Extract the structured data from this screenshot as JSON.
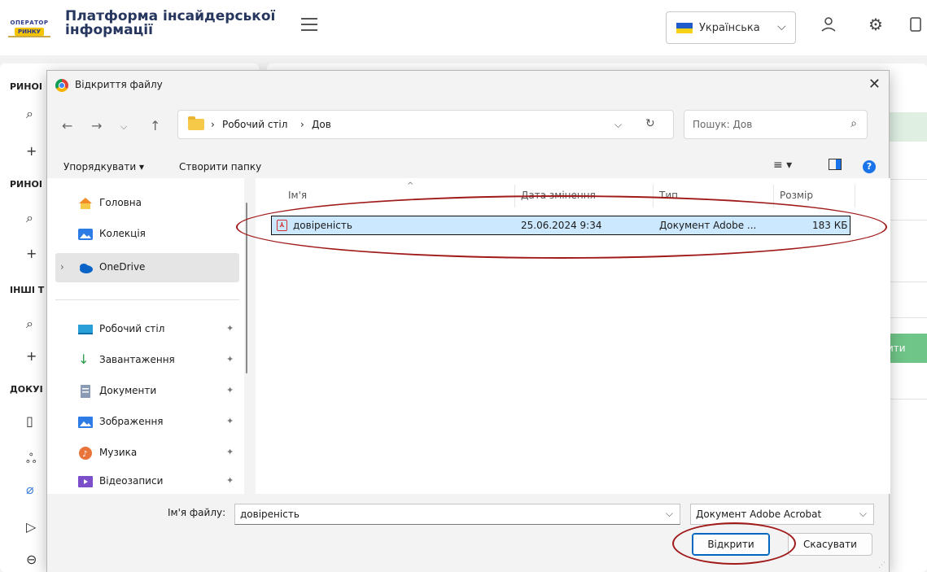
{
  "app": {
    "logo_text": "ОПЕРАТОР РИНКУ",
    "title": "Платформа інсайдерської інформації",
    "language": "Українська"
  },
  "sidebar": {
    "headers": [
      "РИНОІ",
      "РИНОІ",
      "ІНШІ Т",
      "ДОКУІ"
    ]
  },
  "main": {
    "green_button_label": "ити"
  },
  "dialog": {
    "title": "Відкриття файлу",
    "breadcrumb": [
      "Робочий стіл",
      "Дов"
    ],
    "search_placeholder": "Пошук: Дов",
    "toolbar": {
      "organize": "Упорядкувати ▾",
      "new_folder": "Створити папку"
    },
    "nav_items": [
      {
        "label": "Головна",
        "icon": "home-icon",
        "pinned": false
      },
      {
        "label": "Колекція",
        "icon": "gallery-icon",
        "pinned": false
      },
      {
        "label": "OneDrive",
        "icon": "cloud-icon",
        "pinned": false,
        "selected": true
      },
      {
        "label": "Робочий стіл",
        "icon": "desktop-icon",
        "pinned": true
      },
      {
        "label": "Завантаження",
        "icon": "download-icon",
        "pinned": true
      },
      {
        "label": "Документи",
        "icon": "documents-icon",
        "pinned": true
      },
      {
        "label": "Зображення",
        "icon": "pictures-icon",
        "pinned": true
      },
      {
        "label": "Музика",
        "icon": "music-icon",
        "pinned": true
      },
      {
        "label": "Відеозаписи",
        "icon": "videos-icon",
        "pinned": true
      }
    ],
    "columns": [
      "Ім'я",
      "Дата змінення",
      "Тип",
      "Розмір"
    ],
    "files": [
      {
        "name": "довіреність",
        "modified": "25.06.2024 9:34",
        "type": "Документ Adobe ...",
        "size": "183 КБ"
      }
    ],
    "file_name_label": "Ім'я файлу:",
    "file_name_value": "довіреність",
    "file_type": "Документ Adobe Acrobat",
    "open_button": "Відкрити",
    "cancel_button": "Скасувати"
  },
  "colors": {
    "selection": "#cce8ff",
    "accent": "#0067c0",
    "annotation": "#a11a1a",
    "green": "#6fc487"
  }
}
